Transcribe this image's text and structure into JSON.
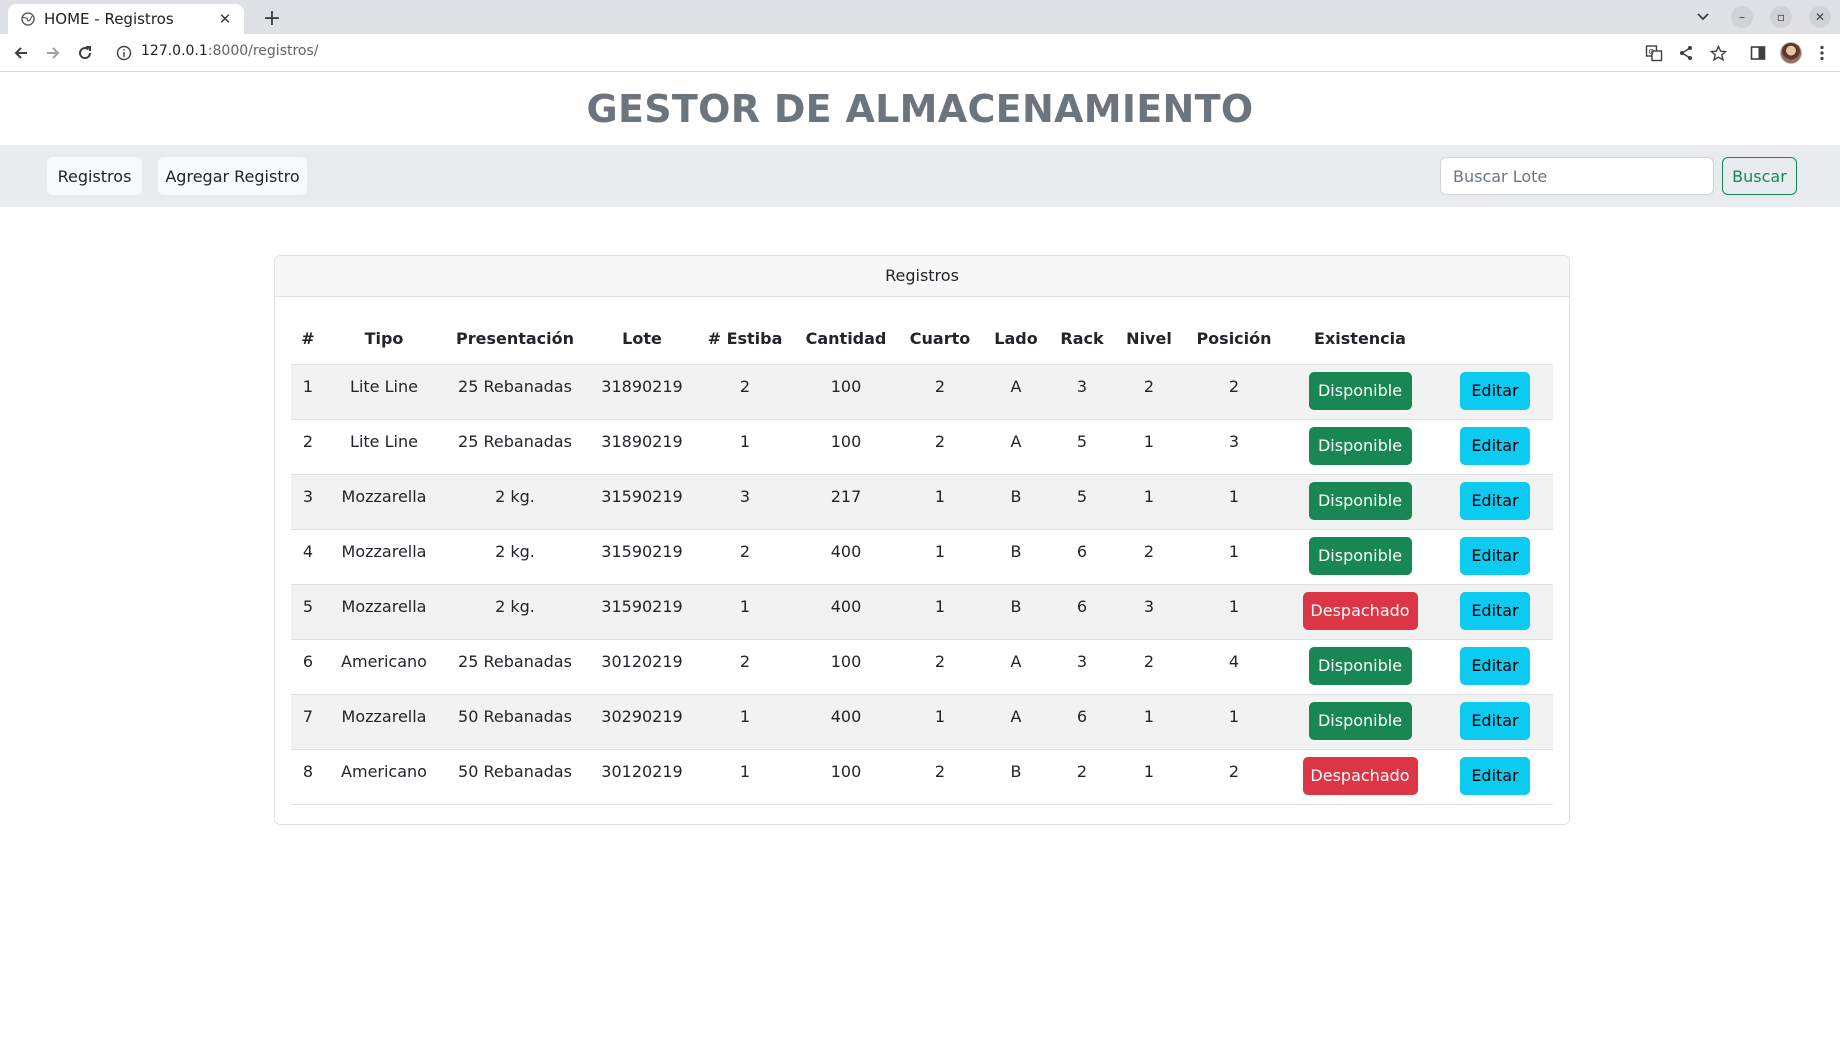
{
  "browser": {
    "tab_title": "HOME - Registros",
    "url_host": "127.0.0.1",
    "url_path": ":8000/registros/"
  },
  "header": {
    "title": "GESTOR DE ALMACENAMIENTO"
  },
  "nav": {
    "registros_label": "Registros",
    "agregar_label": "Agregar Registro",
    "search_placeholder": "Buscar Lote",
    "search_value": "",
    "search_button": "Buscar"
  },
  "card": {
    "title": "Registros"
  },
  "table": {
    "headers": [
      "#",
      "Tipo",
      "Presentación",
      "Lote",
      "# Estiba",
      "Cantidad",
      "Cuarto",
      "Lado",
      "Rack",
      "Nivel",
      "Posición",
      "Existencia",
      ""
    ],
    "edit_label": "Editar",
    "rows": [
      {
        "num": "1",
        "tipo": "Lite Line",
        "presentacion": "25 Rebanadas",
        "lote": "31890219",
        "estiba": "2",
        "cantidad": "100",
        "cuarto": "2",
        "lado": "A",
        "rack": "3",
        "nivel": "2",
        "posicion": "2",
        "existencia": "Disponible"
      },
      {
        "num": "2",
        "tipo": "Lite Line",
        "presentacion": "25 Rebanadas",
        "lote": "31890219",
        "estiba": "1",
        "cantidad": "100",
        "cuarto": "2",
        "lado": "A",
        "rack": "5",
        "nivel": "1",
        "posicion": "3",
        "existencia": "Disponible"
      },
      {
        "num": "3",
        "tipo": "Mozzarella",
        "presentacion": "2 kg.",
        "lote": "31590219",
        "estiba": "3",
        "cantidad": "217",
        "cuarto": "1",
        "lado": "B",
        "rack": "5",
        "nivel": "1",
        "posicion": "1",
        "existencia": "Disponible"
      },
      {
        "num": "4",
        "tipo": "Mozzarella",
        "presentacion": "2 kg.",
        "lote": "31590219",
        "estiba": "2",
        "cantidad": "400",
        "cuarto": "1",
        "lado": "B",
        "rack": "6",
        "nivel": "2",
        "posicion": "1",
        "existencia": "Disponible"
      },
      {
        "num": "5",
        "tipo": "Mozzarella",
        "presentacion": "2 kg.",
        "lote": "31590219",
        "estiba": "1",
        "cantidad": "400",
        "cuarto": "1",
        "lado": "B",
        "rack": "6",
        "nivel": "3",
        "posicion": "1",
        "existencia": "Despachado"
      },
      {
        "num": "6",
        "tipo": "Americano",
        "presentacion": "25 Rebanadas",
        "lote": "30120219",
        "estiba": "2",
        "cantidad": "100",
        "cuarto": "2",
        "lado": "A",
        "rack": "3",
        "nivel": "2",
        "posicion": "4",
        "existencia": "Disponible"
      },
      {
        "num": "7",
        "tipo": "Mozzarella",
        "presentacion": "50 Rebanadas",
        "lote": "30290219",
        "estiba": "1",
        "cantidad": "400",
        "cuarto": "1",
        "lado": "A",
        "rack": "6",
        "nivel": "1",
        "posicion": "1",
        "existencia": "Disponible"
      },
      {
        "num": "8",
        "tipo": "Americano",
        "presentacion": "50 Rebanadas",
        "lote": "30120219",
        "estiba": "1",
        "cantidad": "100",
        "cuarto": "2",
        "lado": "B",
        "rack": "2",
        "nivel": "1",
        "posicion": "2",
        "existencia": "Despachado"
      }
    ]
  },
  "colors": {
    "disponible": "#198754",
    "despachado": "#dc3545",
    "editar": "#0dcaf0",
    "title": "#6c757d"
  }
}
